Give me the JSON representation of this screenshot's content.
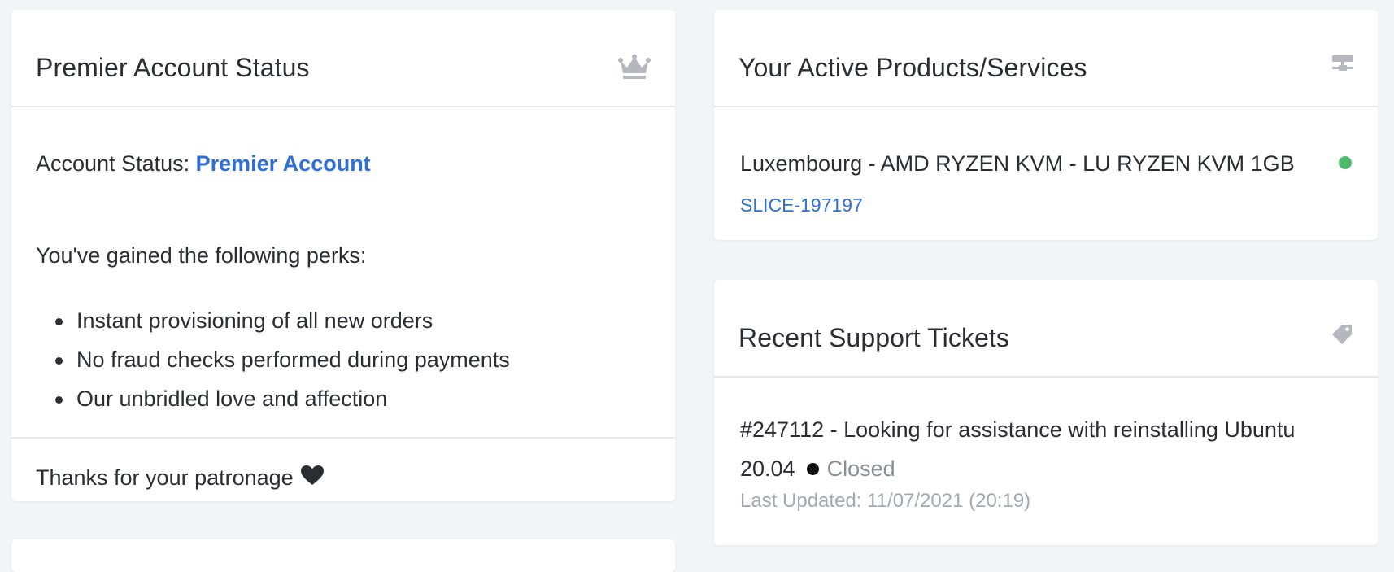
{
  "premier": {
    "title": "Premier Account Status",
    "icon": "crown-icon",
    "status_label": "Account Status: ",
    "status_value": "Premier Account",
    "perks_intro": "You've gained the following perks:",
    "perks": [
      "Instant provisioning of all new orders",
      "No fraud checks performed during payments",
      "Our unbridled love and affection"
    ],
    "footer_text": "Thanks for your patronage",
    "footer_icon": "heart-icon"
  },
  "products": {
    "title": "Your Active Products/Services",
    "icon": "server-icon",
    "items": [
      {
        "name": "Luxembourg - AMD RYZEN KVM - LU RYZEN KVM 1GB",
        "id": "SLICE-197197",
        "status_color": "#4cbb6c"
      }
    ]
  },
  "tickets": {
    "title": "Recent Support Tickets",
    "icon": "tag-icon",
    "items": [
      {
        "subject": "#247112 - Looking for assistance with reinstalling Ubuntu 20.04",
        "status": "Closed",
        "updated": "Last Updated: 11/07/2021 (20:19)"
      }
    ]
  },
  "colors": {
    "accent": "#2f6fd6",
    "active": "#4cbb6c",
    "muted": "#a4a8b0"
  }
}
